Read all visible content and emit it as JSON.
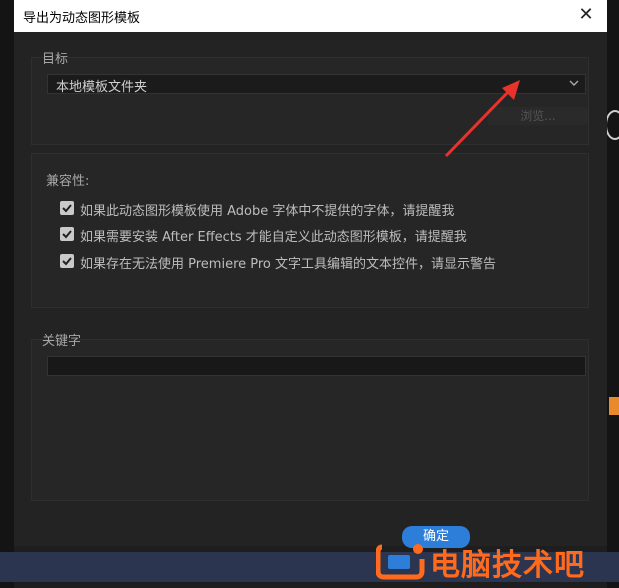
{
  "dialog": {
    "title": "导出为动态图形模板",
    "close_glyph": "✕"
  },
  "target": {
    "label": "目标",
    "selected": "本地模板文件夹",
    "browse_label": "浏览..."
  },
  "compatibility": {
    "label": "兼容性:",
    "options": [
      {
        "label": "如果此动态图形模板使用 Adobe 字体中不提供的字体，请提醒我",
        "checked": true
      },
      {
        "label": "如果需要安装 After Effects 才能自定义此动态图形模板，请提醒我",
        "checked": true
      },
      {
        "label": "如果存在无法使用 Premiere Pro 文字工具编辑的文本控件，请显示警告",
        "checked": true
      }
    ]
  },
  "keywords": {
    "label": "关键字",
    "value": ""
  },
  "footer": {
    "ok_label": "确定"
  },
  "watermark": {
    "text": "电脑技术吧"
  },
  "colors": {
    "dialog_bg": "#232323",
    "titlebar_bg": "#ffffff",
    "accent_blue": "#2d7ed8",
    "annotation_red": "#e8322b",
    "watermark_orange": "#ff6a1c"
  }
}
